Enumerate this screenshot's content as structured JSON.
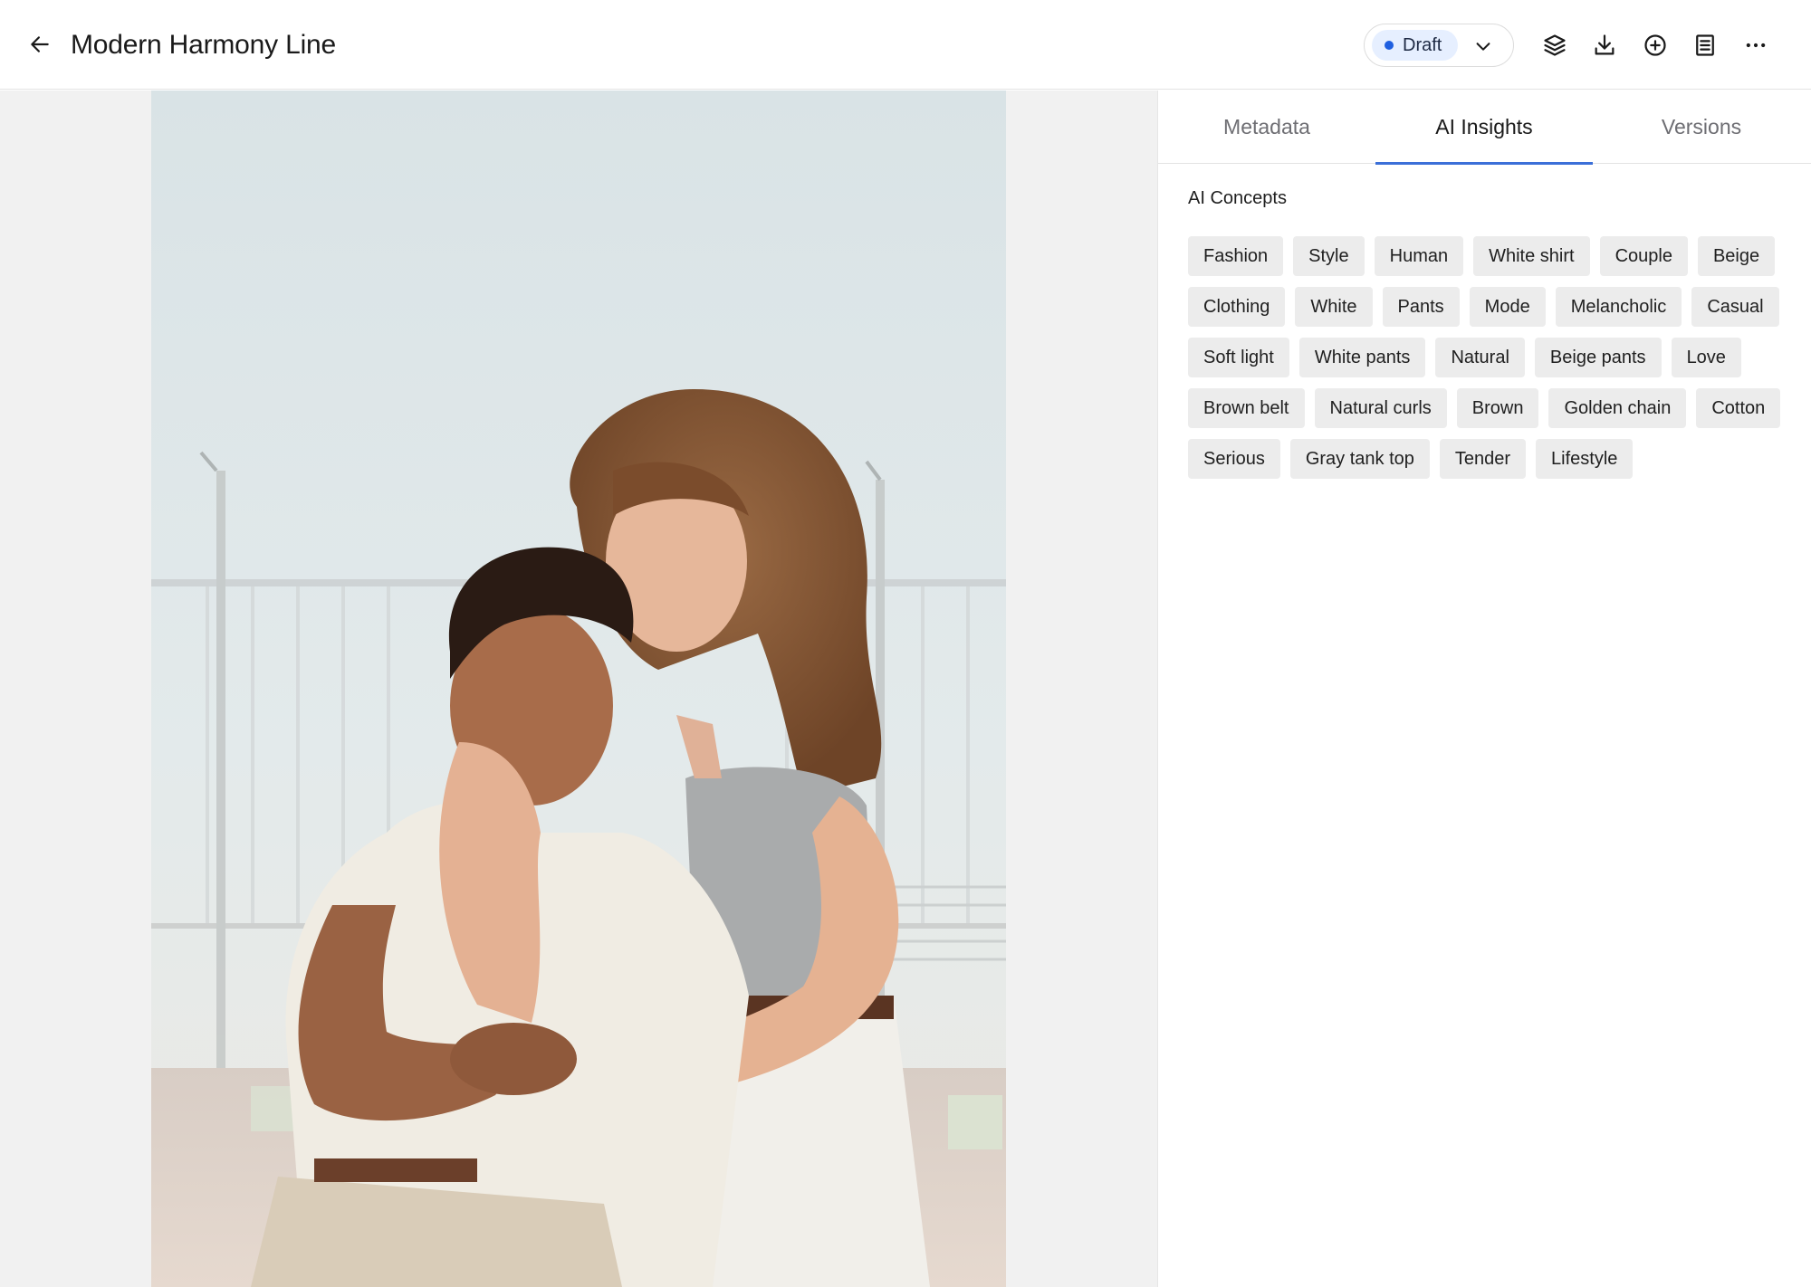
{
  "header": {
    "title": "Modern Harmony Line",
    "status": {
      "label": "Draft",
      "color": "#1f5fe0"
    }
  },
  "toolbar": {
    "icons": [
      "layers-icon",
      "download-icon",
      "add-circle-icon",
      "document-icon",
      "more-icon"
    ]
  },
  "side_panel": {
    "tabs": [
      {
        "label": "Metadata",
        "active": false
      },
      {
        "label": "AI Insights",
        "active": true
      },
      {
        "label": "Versions",
        "active": false
      }
    ],
    "section_title": "AI Concepts",
    "concepts": [
      "Fashion",
      "Style",
      "Human",
      "White shirt",
      "Couple",
      "Beige",
      "Clothing",
      "White",
      "Pants",
      "Mode",
      "Melancholic",
      "Casual",
      "Soft light",
      "White pants",
      "Natural",
      "Beige pants",
      "Love",
      "Brown belt",
      "Natural curls",
      "Brown",
      "Golden chain",
      "Cotton",
      "Serious",
      "Gray tank top",
      "Tender",
      "Lifestyle"
    ]
  },
  "colors": {
    "accent": "#3b6fd8",
    "chip_bg": "#ececec",
    "viewer_bg": "#f1f1f1"
  }
}
